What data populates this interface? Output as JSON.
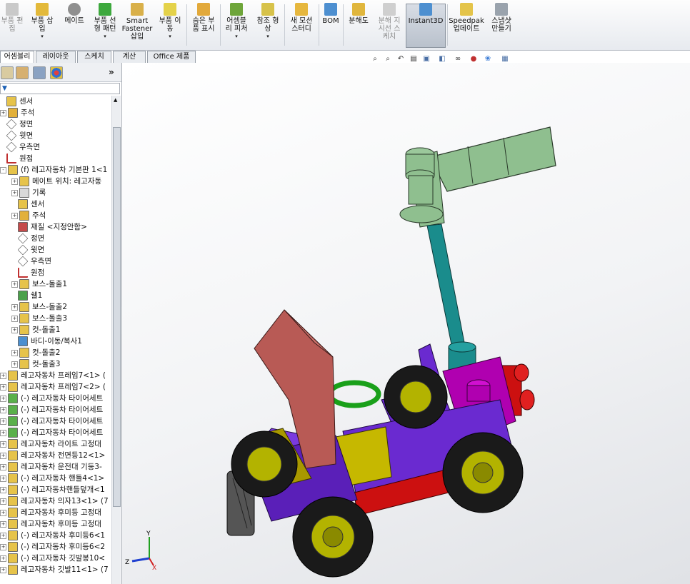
{
  "ribbon": {
    "buttons": [
      {
        "label": "부품 편\n집",
        "icon": "edit-component-icon",
        "disabled": true
      },
      {
        "label": "부품 삽\n입",
        "icon": "insert-component-icon",
        "disabled": false
      },
      {
        "label": "메이트",
        "icon": "mate-icon",
        "disabled": false
      },
      {
        "label": "부품 선\n형 패턴",
        "icon": "linear-pattern-icon",
        "disabled": false
      },
      {
        "label": "Smart\nFastener\n삽입",
        "icon": "smart-fastener-icon",
        "disabled": false
      },
      {
        "label": "부품 이\n동",
        "icon": "move-component-icon",
        "disabled": false
      },
      {
        "label": "숨은 부\n품 표시",
        "icon": "show-hidden-icon",
        "disabled": false
      },
      {
        "label": "어셈블\n리 피처",
        "icon": "assembly-features-icon",
        "disabled": false
      },
      {
        "label": "참조 형\n상",
        "icon": "reference-geometry-icon",
        "disabled": false
      },
      {
        "label": "새 모션\n스터디",
        "icon": "motion-study-icon",
        "disabled": false
      },
      {
        "label": "BOM",
        "icon": "bom-icon",
        "disabled": false
      },
      {
        "label": "분해도",
        "icon": "exploded-view-icon",
        "disabled": false
      },
      {
        "label": "분해 지\n시선 스\n케치",
        "icon": "explode-line-sketch-icon",
        "disabled": true
      },
      {
        "label": "Instant3D",
        "icon": "instant3d-icon",
        "disabled": false,
        "active": true
      },
      {
        "label": "Speedpak\n업데이트",
        "icon": "speedpak-icon",
        "disabled": false
      },
      {
        "label": "스냅샷\n만들기",
        "icon": "snapshot-icon",
        "disabled": false
      }
    ]
  },
  "tabs": [
    "어셈블리",
    "레이아웃",
    "스케치",
    "계산",
    "Office 제품"
  ],
  "panel": {
    "collapse": "»",
    "filter": "▼"
  },
  "tree": [
    {
      "label": "센서",
      "icon": "sensor-icon",
      "depth": 0,
      "expander": ""
    },
    {
      "label": "주석",
      "icon": "annotation-icon",
      "depth": 0,
      "expander": "+"
    },
    {
      "label": "정면",
      "icon": "plane-icon",
      "depth": 0,
      "expander": ""
    },
    {
      "label": "윗면",
      "icon": "plane-icon",
      "depth": 0,
      "expander": ""
    },
    {
      "label": "우측면",
      "icon": "plane-icon",
      "depth": 0,
      "expander": ""
    },
    {
      "label": "원점",
      "icon": "origin-icon",
      "depth": 0,
      "expander": ""
    },
    {
      "label": "(f) 레고자동차 기본판 1<1",
      "icon": "part-icon",
      "depth": 0,
      "expander": "-"
    },
    {
      "label": "메이트 위치: 레고자동",
      "icon": "mate-folder-icon",
      "depth": 1,
      "expander": "+"
    },
    {
      "label": "기록",
      "icon": "history-icon",
      "depth": 1,
      "expander": "+"
    },
    {
      "label": "센서",
      "icon": "sensor-icon",
      "depth": 1,
      "expander": ""
    },
    {
      "label": "주석",
      "icon": "annotation-icon",
      "depth": 1,
      "expander": "+"
    },
    {
      "label": "재질 <지정안함>",
      "icon": "material-icon",
      "depth": 1,
      "expander": ""
    },
    {
      "label": "정면",
      "icon": "plane-icon",
      "depth": 1,
      "expander": ""
    },
    {
      "label": "윗면",
      "icon": "plane-icon",
      "depth": 1,
      "expander": ""
    },
    {
      "label": "우측면",
      "icon": "plane-icon",
      "depth": 1,
      "expander": ""
    },
    {
      "label": "원점",
      "icon": "origin-icon",
      "depth": 1,
      "expander": ""
    },
    {
      "label": "보스-돌출1",
      "icon": "boss-extrude-icon",
      "depth": 1,
      "expander": "+"
    },
    {
      "label": "쉘1",
      "icon": "shell-icon",
      "depth": 1,
      "expander": ""
    },
    {
      "label": "보스-돌출2",
      "icon": "boss-extrude-icon",
      "depth": 1,
      "expander": "+"
    },
    {
      "label": "보스-돌출3",
      "icon": "boss-extrude-icon",
      "depth": 1,
      "expander": "+"
    },
    {
      "label": "컷-돌출1",
      "icon": "cut-extrude-icon",
      "depth": 1,
      "expander": "+"
    },
    {
      "label": "바디-이동/복사1",
      "icon": "move-body-icon",
      "depth": 1,
      "expander": ""
    },
    {
      "label": "컷-돌출2",
      "icon": "cut-extrude-icon",
      "depth": 1,
      "expander": "+"
    },
    {
      "label": "컷-돌출3",
      "icon": "cut-extrude-icon",
      "depth": 1,
      "expander": "+"
    },
    {
      "label": "레고자동차 프레임7<1> (",
      "icon": "part-icon",
      "depth": 0,
      "expander": "+"
    },
    {
      "label": "레고자동차 프레임7<2> (",
      "icon": "part-icon",
      "depth": 0,
      "expander": "+"
    },
    {
      "label": "(-) 레고자동차 타이어세트",
      "icon": "part-green-icon",
      "depth": 0,
      "expander": "+"
    },
    {
      "label": "(-) 레고자동차 타이어세트",
      "icon": "part-green-icon",
      "depth": 0,
      "expander": "+"
    },
    {
      "label": "(-) 레고자동차 타이어세트",
      "icon": "part-green-icon",
      "depth": 0,
      "expander": "+"
    },
    {
      "label": "(-) 레고자동차 타이어세트",
      "icon": "part-green-icon",
      "depth": 0,
      "expander": "+"
    },
    {
      "label": "레고자동차 라이트 고정대",
      "icon": "part-icon",
      "depth": 0,
      "expander": "+"
    },
    {
      "label": "레고자동차 전면등12<1>",
      "icon": "part-icon",
      "depth": 0,
      "expander": "+"
    },
    {
      "label": "레고자동차 운전대 기둥3-",
      "icon": "part-icon",
      "depth": 0,
      "expander": "+"
    },
    {
      "label": "(-) 레고자동차 핸들4<1>",
      "icon": "part-icon",
      "depth": 0,
      "expander": "+"
    },
    {
      "label": "(-) 레고자동차핸들덮개<1",
      "icon": "part-icon",
      "depth": 0,
      "expander": "+"
    },
    {
      "label": "레고자동차 의자13<1> (7",
      "icon": "part-icon",
      "depth": 0,
      "expander": "+"
    },
    {
      "label": "레고자동차 후미등 고정대",
      "icon": "part-icon",
      "depth": 0,
      "expander": "+"
    },
    {
      "label": "레고자동차 후미등 고정대",
      "icon": "part-icon",
      "depth": 0,
      "expander": "+"
    },
    {
      "label": "(-) 레고자동차 후미등6<1",
      "icon": "part-icon",
      "depth": 0,
      "expander": "+"
    },
    {
      "label": "(-) 레고자동차 후미등6<2",
      "icon": "part-icon",
      "depth": 0,
      "expander": "+"
    },
    {
      "label": "(-) 레고자동차 깃발봉10<",
      "icon": "part-icon",
      "depth": 0,
      "expander": "+"
    },
    {
      "label": "레고자동차 깃발11<1> (7",
      "icon": "part-icon",
      "depth": 0,
      "expander": "+"
    }
  ],
  "viewport": {
    "triad": {
      "x": "X",
      "y": "Y",
      "z": "Z"
    },
    "heads_up_toolbar": [
      "zoom-to-fit-icon",
      "zoom-area-icon",
      "previous-view-icon",
      "section-view-icon",
      "view-orientation-icon",
      "display-style-icon",
      "hide-show-icon",
      "edit-appearance-icon",
      "apply-scene-icon",
      "view-settings-icon"
    ]
  },
  "colors": {
    "seat": "#b85a55",
    "chassis": "#5a1fb8",
    "yellow": "#c6b800",
    "red": "#cc1010",
    "magenta": "#b000b0",
    "pole": "#1a8c8c",
    "flag": "#8fbf8f",
    "tire": "#1a1a1a",
    "rim": "#b3b300"
  }
}
